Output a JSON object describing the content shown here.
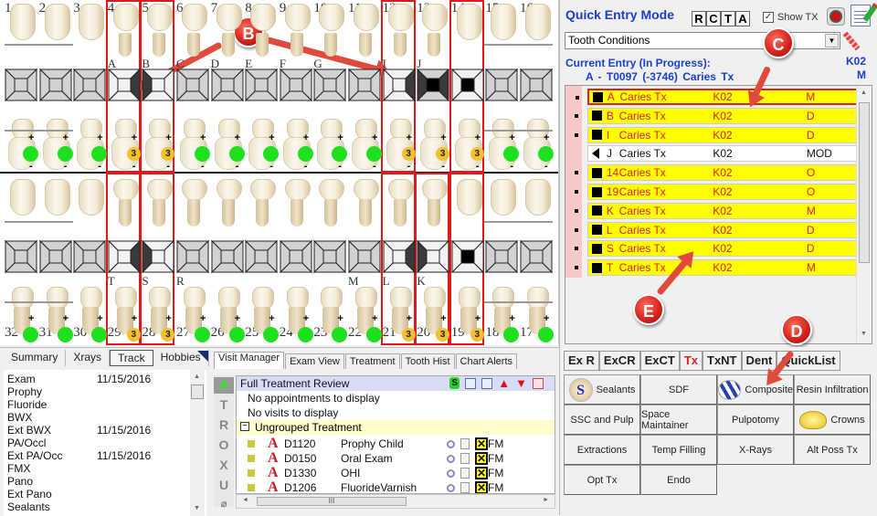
{
  "chart": {
    "upper_numbers": [
      "1",
      "2",
      "3",
      "4",
      "5",
      "6",
      "7",
      "8",
      "9",
      "10",
      "11",
      "12",
      "13",
      "14",
      "15",
      "16"
    ],
    "upper_letters": [
      "",
      "",
      "",
      "A",
      "B",
      "C",
      "D",
      "E",
      "F",
      "G",
      "",
      "I",
      "J",
      "",
      "",
      ""
    ],
    "lower_numbers": [
      "32",
      "31",
      "30",
      "29",
      "28",
      "27",
      "26",
      "25",
      "24",
      "23",
      "22",
      "21",
      "20",
      "19",
      "18",
      "17"
    ],
    "lower_letters": [
      "",
      "",
      "",
      "T",
      "S",
      "R",
      "",
      "",
      "",
      "",
      "M",
      "L",
      "K",
      "",
      "",
      ""
    ],
    "upper_surfaces": [
      "none",
      "none",
      "none",
      "distal",
      "mesial",
      "none",
      "none",
      "none",
      "none",
      "none",
      "none",
      "distal",
      "mod",
      "occlusal",
      "none",
      "none"
    ],
    "lower_surfaces": [
      "none",
      "none",
      "none",
      "distal",
      "mesial",
      "none",
      "none",
      "none",
      "none",
      "none",
      "none",
      "distal",
      "mesial",
      "occlusal",
      "none",
      "none"
    ],
    "upper_markers": [
      "green",
      "green",
      "green",
      "3",
      "3",
      "green",
      "green",
      "green",
      "green",
      "green",
      "green",
      "3",
      "3",
      "3",
      "green",
      "green"
    ],
    "lower_markers": [
      "green",
      "green",
      "green",
      "3",
      "3",
      "green",
      "green",
      "green",
      "green",
      "green",
      "green",
      "3",
      "3",
      "3",
      "green",
      "green"
    ],
    "boxed_upper": [
      3,
      4,
      11,
      13
    ],
    "boxed_lower": [
      3,
      4,
      11,
      12,
      13
    ],
    "annotations": [
      "B",
      "C",
      "D",
      "E"
    ],
    "plus": "+",
    "minus": "-"
  },
  "quick_entry": {
    "title": "Quick Entry Mode",
    "rcta": [
      "R",
      "C",
      "T",
      "A"
    ],
    "show_tx_label": "Show TX",
    "show_tx_checked": "✓",
    "condition_select": "Tooth Conditions",
    "current_entry_label": "Current Entry (In Progress):",
    "current_entry_detail": "A - T0097  (-3746)  Caries Tx",
    "current_code": "K02",
    "current_surface": "M",
    "entries": [
      {
        "tooth": "A",
        "desc": "Caries Tx",
        "code": "K02",
        "surface": "M",
        "style": "selected"
      },
      {
        "tooth": "B",
        "desc": "Caries Tx",
        "code": "K02",
        "surface": "D",
        "style": "yellow"
      },
      {
        "tooth": "I",
        "desc": "Caries Tx",
        "code": "K02",
        "surface": "D",
        "style": "yellow"
      },
      {
        "tooth": "J",
        "desc": "Caries Tx",
        "code": "K02",
        "surface": "MOD",
        "style": "white"
      },
      {
        "tooth": "14",
        "desc": "Caries Tx",
        "code": "K02",
        "surface": "O",
        "style": "yellow"
      },
      {
        "tooth": "19",
        "desc": "Caries Tx",
        "code": "K02",
        "surface": "O",
        "style": "yellow"
      },
      {
        "tooth": "K",
        "desc": "Caries Tx",
        "code": "K02",
        "surface": "M",
        "style": "yellow"
      },
      {
        "tooth": "L",
        "desc": "Caries Tx",
        "code": "K02",
        "surface": "D",
        "style": "yellow"
      },
      {
        "tooth": "S",
        "desc": "Caries Tx",
        "code": "K02",
        "surface": "D",
        "style": "yellow"
      },
      {
        "tooth": "T",
        "desc": "Caries Tx",
        "code": "K02",
        "surface": "M",
        "style": "yellow"
      }
    ]
  },
  "procedures": {
    "category_tabs": [
      {
        "label": "Ex R",
        "active": false
      },
      {
        "label": "ExCR",
        "active": false
      },
      {
        "label": "ExCT",
        "active": false
      },
      {
        "label": "Tx",
        "active": true
      },
      {
        "label": "TxNT",
        "active": false
      },
      {
        "label": "Dent",
        "active": false
      },
      {
        "label": "QuickList",
        "active": false
      }
    ],
    "buttons": [
      {
        "label": "Sealants",
        "icon": "sealant-icon"
      },
      {
        "label": "SDF",
        "icon": ""
      },
      {
        "label": "Composite",
        "icon": "composite-icon"
      },
      {
        "label": "Resin Infiltration",
        "icon": ""
      },
      {
        "label": "SSC and Pulp",
        "icon": ""
      },
      {
        "label": "Space Maintainer",
        "icon": ""
      },
      {
        "label": "Pulpotomy",
        "icon": ""
      },
      {
        "label": "Crowns",
        "icon": "crown-icon"
      },
      {
        "label": "Extractions",
        "icon": ""
      },
      {
        "label": "Temp Filling",
        "icon": ""
      },
      {
        "label": "X-Rays",
        "icon": ""
      },
      {
        "label": "Alt Poss Tx",
        "icon": ""
      },
      {
        "label": "Opt Tx",
        "icon": ""
      },
      {
        "label": "Endo",
        "icon": ""
      }
    ]
  },
  "track": {
    "tabs": [
      {
        "label": "Summary",
        "active": false
      },
      {
        "label": "Xrays",
        "active": false
      },
      {
        "label": "Track",
        "active": true
      },
      {
        "label": "Hobbies",
        "active": false
      }
    ],
    "rows": [
      {
        "name": "Exam",
        "date": "11/15/2016"
      },
      {
        "name": "Prophy",
        "date": ""
      },
      {
        "name": "Fluoride",
        "date": ""
      },
      {
        "name": "BWX",
        "date": ""
      },
      {
        "name": "Ext BWX",
        "date": "11/15/2016"
      },
      {
        "name": "PA/Occl",
        "date": ""
      },
      {
        "name": "Ext PA/Occ",
        "date": "11/15/2016"
      },
      {
        "name": "FMX",
        "date": ""
      },
      {
        "name": "Pano",
        "date": ""
      },
      {
        "name": "Ext Pano",
        "date": ""
      },
      {
        "name": "Sealants",
        "date": ""
      }
    ]
  },
  "visit": {
    "tabs": [
      {
        "label": "Visit Manager",
        "active": true
      },
      {
        "label": "Exam View",
        "active": false
      },
      {
        "label": "Treatment",
        "active": false
      },
      {
        "label": "Tooth Hist",
        "active": false
      },
      {
        "label": "Chart Alerts",
        "active": false
      }
    ],
    "side_letters": [
      "A",
      "T",
      "R",
      "O",
      "X",
      "U"
    ],
    "header": "Full Treatment Review",
    "header_s": "S",
    "no_appts": "No appointments to display",
    "no_visits": "No visits to display",
    "ungrouped": "Ungrouped Treatment",
    "items": [
      {
        "code": "D1120",
        "name": "Prophy Child",
        "area": "FM"
      },
      {
        "code": "D0150",
        "name": "Oral Exam",
        "area": "FM"
      },
      {
        "code": "D1330",
        "name": "OHI",
        "area": "FM"
      },
      {
        "code": "D1206",
        "name": "FluorideVarnish",
        "area": "FM"
      }
    ],
    "a_glyph": "A",
    "x_glyph": "✕",
    "scroll_grip": "III"
  }
}
